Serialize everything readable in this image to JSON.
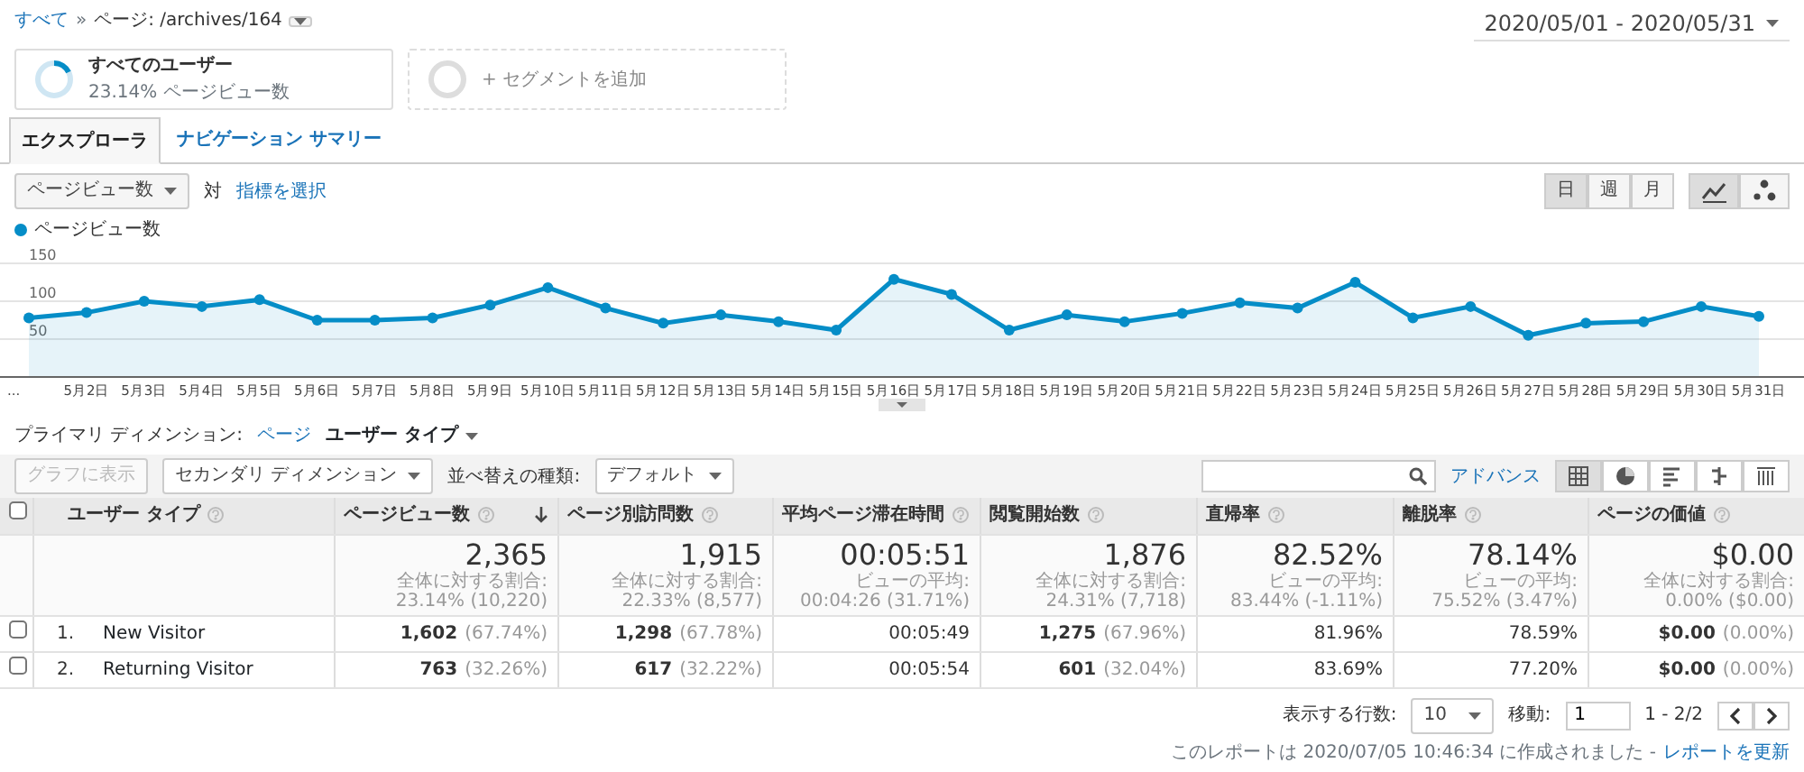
{
  "breadcrumb": {
    "root": "すべて",
    "separator": "»",
    "current": "ページ: /archives/164"
  },
  "date_range": "2020/05/01 - 2020/05/31",
  "segments": [
    {
      "kind": "segment",
      "name": "すべてのユーザー",
      "detail": "23.14% ページビュー数"
    },
    {
      "kind": "add",
      "name": "+ セグメントを追加"
    }
  ],
  "tabs": [
    {
      "label": "エクスプローラ",
      "selected": true
    },
    {
      "label": "ナビゲーション サマリー",
      "selected": false
    }
  ],
  "metric": {
    "value": "ページビュー数",
    "versus": "対",
    "select_link": "指標を選択"
  },
  "intervals": [
    {
      "label": "日",
      "selected": true
    },
    {
      "label": "週",
      "selected": false
    },
    {
      "label": "月",
      "selected": false
    }
  ],
  "chart_types": [
    {
      "kind": "line",
      "selected": true
    },
    {
      "kind": "motion",
      "selected": false
    }
  ],
  "chart": {
    "chart_data": {
      "type": "area",
      "grid": true,
      "categories": [
        "...",
        "5月2日",
        "5月3日",
        "5月4日",
        "5月5日",
        "5月6日",
        "5月7日",
        "5月8日",
        "5月9日",
        "5月10日",
        "5月11日",
        "5月12日",
        "5月13日",
        "5月14日",
        "5月15日",
        "5月16日",
        "5月17日",
        "5月18日",
        "5月19日",
        "5月20日",
        "5月21日",
        "5月22日",
        "5月23日",
        "5月24日",
        "5月25日",
        "5月26日",
        "5月27日",
        "5月28日",
        "5月29日",
        "5月30日",
        "5月31日"
      ],
      "ylim": [
        0,
        150
      ],
      "yticks": [
        50,
        100,
        150
      ],
      "series": [
        {
          "name": "ページビュー数",
          "color": "#058dc7",
          "values": [
            78,
            85,
            100,
            93,
            102,
            75,
            75,
            78,
            95,
            118,
            91,
            71,
            82,
            73,
            62,
            129,
            109,
            62,
            82,
            73,
            84,
            98,
            91,
            125,
            78,
            93,
            55,
            71,
            73,
            93,
            80
          ]
        }
      ]
    }
  },
  "primary_dimension": {
    "label": "プライマリ ディメンション:",
    "options": [
      {
        "label": "ページ",
        "selected": false
      },
      {
        "label": "ユーザー タイプ",
        "selected": true
      }
    ]
  },
  "toolbar": {
    "plot_button": {
      "label": "グラフに表示",
      "disabled": true
    },
    "secondary": "セカンダリ ディメンション",
    "sort_label": "並べ替えの種類:",
    "sort_value": "デフォルト",
    "advanced": "アドバンス",
    "views": [
      {
        "kind": "table",
        "selected": true
      },
      {
        "kind": "pie",
        "selected": false
      },
      {
        "kind": "performance",
        "selected": false
      },
      {
        "kind": "comparison",
        "selected": false
      },
      {
        "kind": "pivot",
        "selected": false
      }
    ]
  },
  "table": {
    "select_all_checked": false,
    "columns": [
      {
        "label": "ユーザー タイプ",
        "sorted": false
      },
      {
        "label": "ページビュー数",
        "sorted": true
      },
      {
        "label": "ページ別訪問数",
        "sorted": false
      },
      {
        "label": "平均ページ滞在時間",
        "sorted": false
      },
      {
        "label": "閲覧開始数",
        "sorted": false
      },
      {
        "label": "直帰率",
        "sorted": false
      },
      {
        "label": "離脱率",
        "sorted": false
      },
      {
        "label": "ページの価値",
        "sorted": false
      }
    ],
    "totals": [
      {
        "value": "2,365",
        "detail": "全体に対する割合: 23.14% (10,220)"
      },
      {
        "value": "1,915",
        "detail": "全体に対する割合: 22.33% (8,577)"
      },
      {
        "value": "00:05:51",
        "detail": "ビューの平均: 00:04:26 (31.71%)"
      },
      {
        "value": "1,876",
        "detail": "全体に対する割合: 24.31% (7,718)"
      },
      {
        "value": "82.52%",
        "detail": "ビューの平均: 83.44% (-1.11%)"
      },
      {
        "value": "78.14%",
        "detail": "ビューの平均: 75.52% (3.47%)"
      },
      {
        "value": "$0.00",
        "detail": "全体に対する割合: 0.00% ($0.00)"
      }
    ],
    "rows": [
      {
        "checked": false,
        "index": "1.",
        "cells": [
          {
            "value": "New Visitor"
          },
          {
            "value": "1,602",
            "share": "(67.74%)"
          },
          {
            "value": "1,298",
            "share": "(67.78%)"
          },
          {
            "value": "00:05:49"
          },
          {
            "value": "1,275",
            "share": "(67.96%)"
          },
          {
            "value": "81.96%"
          },
          {
            "value": "78.59%"
          },
          {
            "value": "$0.00",
            "share": "(0.00%)"
          }
        ]
      },
      {
        "checked": false,
        "index": "2.",
        "cells": [
          {
            "value": "Returning Visitor"
          },
          {
            "value": "763",
            "share": "(32.26%)"
          },
          {
            "value": "617",
            "share": "(32.22%)"
          },
          {
            "value": "00:05:54"
          },
          {
            "value": "601",
            "share": "(32.04%)"
          },
          {
            "value": "83.69%"
          },
          {
            "value": "77.20%"
          },
          {
            "value": "$0.00",
            "share": "(0.00%)"
          }
        ]
      }
    ]
  },
  "pagination": {
    "rows_label": "表示する行数:",
    "rows_value": "10",
    "goto_label": "移動:",
    "goto_value": "1",
    "range": "1 - 2/2"
  },
  "footer": {
    "text": "このレポートは 2020/07/05 10:46:34 に作成されました -",
    "link": "レポートを更新"
  }
}
